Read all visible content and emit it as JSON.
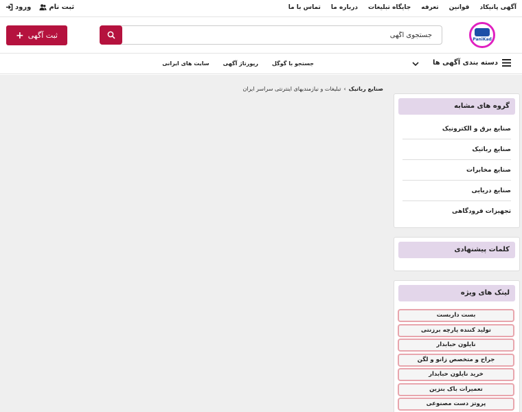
{
  "topbar": {
    "nav": [
      "آگهی پانیکاد",
      "قوانین",
      "تعرفه",
      "جایگاه تبلیغات",
      "درباره ما",
      "تماس با ما"
    ],
    "login": "ورود",
    "register": "ثبت نام"
  },
  "header": {
    "logo_text": "PaniKad",
    "search_placeholder": "جستجوی آگهی",
    "post_button": "ثبت آگهی"
  },
  "navrow": {
    "categories": "دسته بندی آگهی ها",
    "links": [
      "جستجو با گوگل",
      "رپورتاژ آگهی",
      "سایت های ایرانی"
    ]
  },
  "breadcrumb": {
    "current": "صنایع رباتیک",
    "separator": "›",
    "parent": "تبلیغات و نیازمندیهای اینترنتی سراسر ایران"
  },
  "similar_groups": {
    "title": "گروه های مشابه",
    "items": [
      "صنایع برق و الکترونیک",
      "صنایع رباتیک",
      "صنایع مخابرات",
      "صنایع دریایی",
      "تجهیزات فرودگاهی"
    ]
  },
  "suggested_keywords": {
    "title": "کلمات پیشنهادی"
  },
  "special_links": {
    "title": "لینک های ویژه",
    "items": [
      "بست داربست",
      "تولید کننده پارچه برزنتی",
      "نایلون حبابدار",
      "جراح و متخصص زانو و لگن",
      "خرید نایلون حبابدار",
      "تعمیرات باک بنزین",
      "پروتز دست مصنوعی"
    ]
  },
  "colors": {
    "accent": "#b5123e",
    "box_head": "#e3d6ea",
    "link_border": "#e8a5ad"
  }
}
